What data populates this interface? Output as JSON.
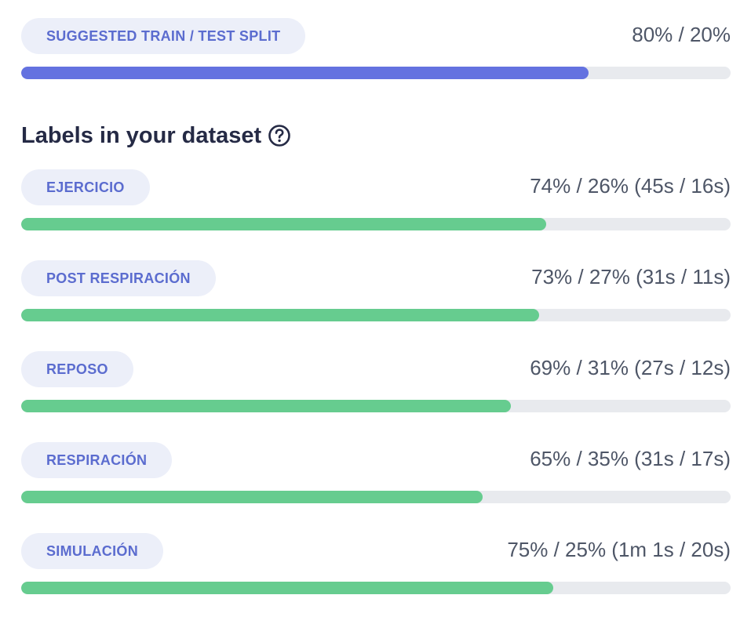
{
  "split": {
    "label": "SUGGESTED TRAIN / TEST SPLIT",
    "value": "80% / 20%",
    "train_fraction": 0.8,
    "color": "#6472e0"
  },
  "labels_section": {
    "title": "Labels in your dataset",
    "help_icon": "question-circle-icon"
  },
  "labels": [
    {
      "name": "EJERCICIO",
      "value": "74% / 26% (45s / 16s)",
      "train_fraction": 0.74
    },
    {
      "name": "POST RESPIRACIÓN",
      "value": "73% / 27% (31s / 11s)",
      "train_fraction": 0.73
    },
    {
      "name": "REPOSO",
      "value": "69% / 31% (27s / 12s)",
      "train_fraction": 0.69
    },
    {
      "name": "RESPIRACIÓN",
      "value": "65% / 35% (31s / 17s)",
      "train_fraction": 0.65
    },
    {
      "name": "SIMULACIÓN",
      "value": "75% / 25% (1m 1s / 20s)",
      "train_fraction": 0.75
    }
  ],
  "colors": {
    "label_bar": "#66cc8f",
    "track": "#e8eaee",
    "pill_bg": "#eceff9",
    "pill_text": "#5b6ccf"
  }
}
